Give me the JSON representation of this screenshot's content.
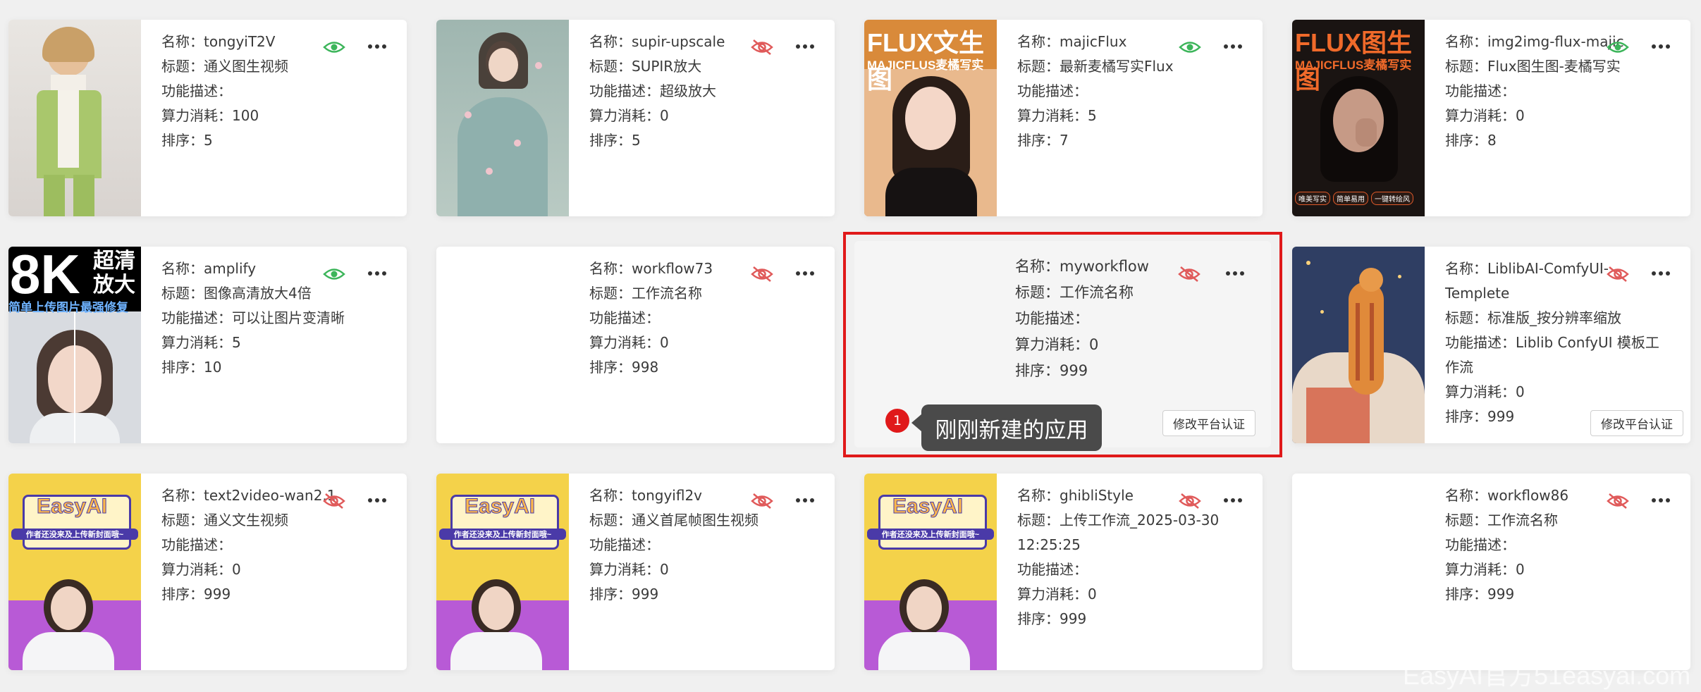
{
  "labels": {
    "name": "名称：",
    "title": "标题：",
    "desc": "功能描述：",
    "cost": "算力消耗：",
    "sort": "排序："
  },
  "colors": {
    "visible_icon": "#3cb55a",
    "hidden_icon": "#e05a5a",
    "highlight": "#e0191a"
  },
  "cards": [
    {
      "name": "tongyiT2V",
      "title": "通义图生视频",
      "desc": "",
      "cost": "100",
      "sort": "5",
      "visible": true,
      "thumb": "woman-green-suit"
    },
    {
      "name": "supir-upscale",
      "title": "SUPIR放大",
      "desc": "超级放大",
      "cost": "0",
      "sort": "5",
      "visible": false,
      "thumb": "woman-floral-dress"
    },
    {
      "name": "majicFlux",
      "title": "最新麦橘写实Flux",
      "desc": "",
      "cost": "5",
      "sort": "7",
      "visible": true,
      "thumb": "flux-poster",
      "thumb_text1": "FLUX文生图",
      "thumb_text2": "MAJICFLUS麦橘写实"
    },
    {
      "name": "img2img-flux-majic",
      "title": "Flux图生图-麦橘写实",
      "desc": "",
      "cost": "0",
      "sort": "8",
      "visible": true,
      "thumb": "flux-img2img-poster",
      "thumb_text1": "FLUX图生图",
      "thumb_text2": "MAJICFLUS麦橘写实",
      "thumb_tags": [
        "唯美写实",
        "简单易用",
        "一键转绘风"
      ]
    },
    {
      "name": "amplify",
      "title": "图像高清放大4倍",
      "desc": "可以让图片变清晰",
      "cost": "5",
      "sort": "10",
      "visible": true,
      "thumb": "8k-poster",
      "thumb_text1": "8K",
      "thumb_text2": "超清放大",
      "thumb_text3": "简单上传图片最强修复"
    },
    {
      "name": "workflow73",
      "title": "工作流名称",
      "desc": "",
      "cost": "0",
      "sort": "998",
      "visible": false,
      "thumb": "blank"
    },
    {
      "name": "myworkflow",
      "title": "工作流名称",
      "desc": "",
      "cost": "0",
      "sort": "999",
      "visible": false,
      "thumb": "blank",
      "auth_button": "修改平台认证"
    },
    {
      "name": "LiblibAI-ComfyUI-Templete",
      "title": "标准版_按分辨率缩放",
      "desc": "Liblib ConfyUI 模板工作流",
      "cost": "0",
      "sort": "999",
      "visible": false,
      "thumb": "tiger-cat",
      "auth_button": "修改平台认证"
    },
    {
      "name": "text2video-wan2.1",
      "title": "通义文生视频",
      "desc": "",
      "cost": "0",
      "sort": "999",
      "visible": false,
      "thumb": "easyai-poster",
      "thumb_text1": "EasyAI",
      "thumb_text2": "作者还没来及上传新封面哦~"
    },
    {
      "name": "tongyifl2v",
      "title": "通义首尾帧图生视频",
      "desc": "",
      "cost": "0",
      "sort": "999",
      "visible": false,
      "thumb": "easyai-poster",
      "thumb_text1": "EasyAI",
      "thumb_text2": "作者还没来及上传新封面哦~"
    },
    {
      "name": "ghibliStyle",
      "title": "上传工作流_2025-03-30 12:25:25",
      "desc": "",
      "cost": "0",
      "sort": "999",
      "visible": false,
      "thumb": "easyai-poster",
      "thumb_text1": "EasyAI",
      "thumb_text2": "作者还没来及上传新封面哦~"
    },
    {
      "name": "workflow86",
      "title": "工作流名称",
      "desc": "",
      "cost": "0",
      "sort": "999",
      "visible": false,
      "thumb": "blank"
    }
  ],
  "tooltip": {
    "badge": "1",
    "text": "刚刚新建的应用"
  },
  "watermark": "EasyAI官方51easyai.com"
}
